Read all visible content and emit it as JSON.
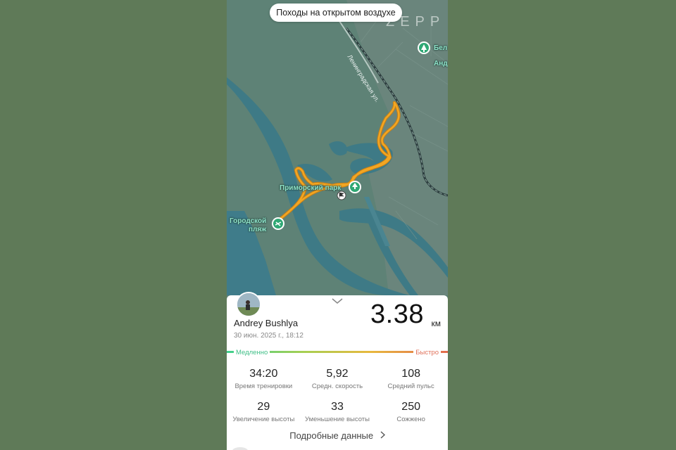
{
  "activity_title": "Походы на открытом воздухе",
  "brand": "ZEPP",
  "map": {
    "street_label": "Ленинградская ул.",
    "poi_top_right": {
      "line1": "Бел",
      "line2": "Анд"
    },
    "poi_park": "Приморский парк",
    "poi_beach": {
      "line1": "Городской",
      "line2": "пляж"
    }
  },
  "user": {
    "name": "Andrey Bushlya",
    "date": "30 июн. 2025 г., 18:12"
  },
  "distance": {
    "value": "3.38",
    "unit": "км"
  },
  "speed_legend": {
    "slow": "Медленно",
    "fast": "Быстро"
  },
  "stats": [
    {
      "value": "34:20",
      "label": "Время тренировки"
    },
    {
      "value": "5,92",
      "label": "Средн. скорость"
    },
    {
      "value": "108",
      "label": "Средний пульс"
    },
    {
      "value": "29",
      "label": "Увеличение высоты"
    },
    {
      "value": "33",
      "label": "Уменьшение высоты"
    },
    {
      "value": "250",
      "label": "Сожжено"
    }
  ],
  "details_link": "Подробные данные",
  "colors": {
    "map_land": "#5b7f73",
    "map_water": "#3e7a86",
    "route": "#f2a623",
    "slow": "#3fcf8e",
    "fast": "#e26b4e"
  }
}
